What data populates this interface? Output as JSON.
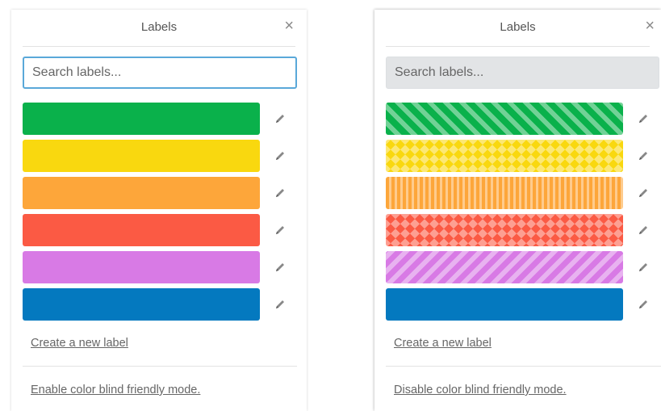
{
  "panels": [
    {
      "title": "Labels",
      "close_symbol": "×",
      "search_placeholder": "Search labels...",
      "create_label": "Create a new label",
      "mode_toggle": "Enable color blind friendly mode.",
      "labels": [
        {
          "color": "#0ab14b",
          "pattern": "none"
        },
        {
          "color": "#f9d80f",
          "pattern": "none"
        },
        {
          "color": "#fda63a",
          "pattern": "none"
        },
        {
          "color": "#fb5a44",
          "pattern": "none"
        },
        {
          "color": "#d87ae5",
          "pattern": "none"
        },
        {
          "color": "#0479bf",
          "pattern": "none"
        }
      ]
    },
    {
      "title": "Labels",
      "close_symbol": "×",
      "search_placeholder": "Search labels...",
      "create_label": "Create a new label",
      "mode_toggle": "Disable color blind friendly mode.",
      "labels": [
        {
          "color": "#0ab14b",
          "pattern": "diagonal-stripes"
        },
        {
          "color": "#f9d80f",
          "pattern": "diamonds"
        },
        {
          "color": "#fda63a",
          "pattern": "vertical-stripes"
        },
        {
          "color": "#fb5a44",
          "pattern": "diamonds"
        },
        {
          "color": "#d87ae5",
          "pattern": "diagonal-stripes-reverse"
        },
        {
          "color": "#0479bf",
          "pattern": "none"
        }
      ]
    }
  ]
}
